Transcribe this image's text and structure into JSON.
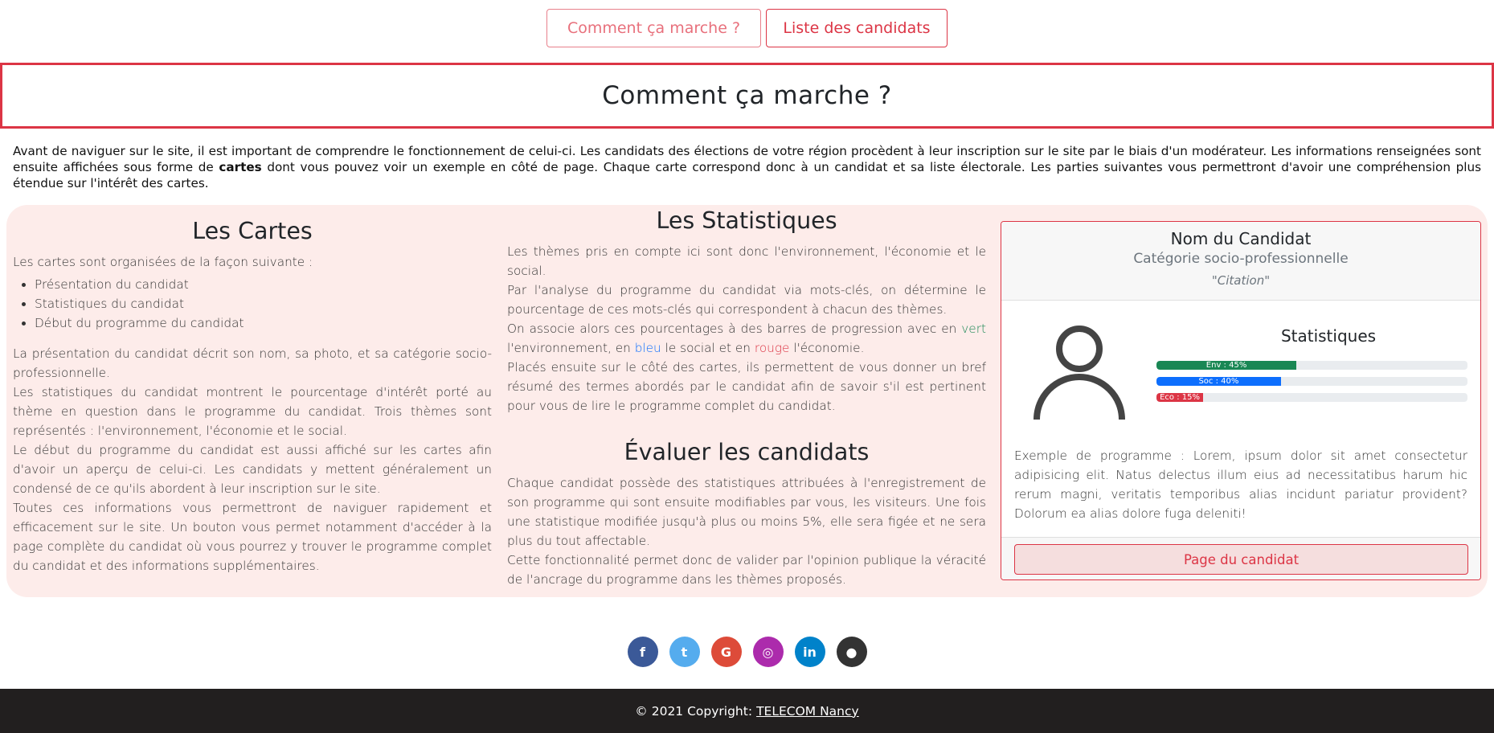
{
  "nav": {
    "how_label": "Comment ça marche ?",
    "list_label": "Liste des candidats"
  },
  "page_title": "Comment ça marche ?",
  "intro": {
    "part1": "Avant de naviguer sur le site, il est important de comprendre le fonctionnement de celui-ci. Les candidats des élections de votre région procèdent à leur inscription sur le site par le biais d'un modérateur. Les informations renseignées sont ensuite affichées sous forme de ",
    "bold": "cartes",
    "part2": " dont vous pouvez voir un exemple en côté de page. Chaque carte correspond donc à un candidat et sa liste électorale. Les parties suivantes vous permettront d'avoir une compréhension plus étendue sur l'intérêt des cartes."
  },
  "cards_section": {
    "title": "Les Cartes",
    "lead": "Les cartes sont organisées de la façon suivante :",
    "items": [
      "Présentation du candidat",
      "Statistiques du candidat",
      "Début du programme du candidat"
    ],
    "p1": "La présentation du candidat décrit son nom, sa photo, et sa catégorie socio-professionnelle.",
    "p2": "Les statistiques du candidat montrent le pourcentage d'intérêt porté au thème en question dans le programme du candidat. Trois thèmes sont représentés : l'environnement, l'économie et le social.",
    "p3": "Le début du programme du candidat est aussi affiché sur les cartes afin d'avoir un aperçu de celui-ci. Les candidats y mettent généralement un condensé de ce qu'ils abordent à leur inscription sur le site.",
    "p4": "Toutes ces informations vous permettront de naviguer rapidement et efficacement sur le site. Un bouton vous permet notamment d'accéder à la page complète du candidat où vous pourrez y trouver le programme complet du candidat et des informations supplémentaires."
  },
  "stats_section": {
    "title": "Les Statistiques",
    "p1": "Les thèmes pris en compte ici sont donc l'environnement, l'économie et le social.",
    "p2": "Par l'analyse du programme du candidat via mots-clés, on détermine le pourcentage de ces mots-clés qui correspondent à chacun des thèmes.",
    "p3a": "On associe alors ces pourcentages à des barres de progression avec en ",
    "green": "vert",
    "p3b": " l'environnement, en ",
    "blue": "bleu",
    "p3c": " le social et en ",
    "red": "rouge",
    "p3d": " l'économie.",
    "p4": "Placés ensuite sur le côté des cartes, ils permettent de vous donner un bref résumé des termes abordés par le candidat afin de savoir s'il est pertinent pour vous de lire le programme complet du candidat."
  },
  "eval_section": {
    "title": "Évaluer les candidats",
    "p1": "Chaque candidat possède des statistiques attribuées à l'enregistrement de son programme qui sont ensuite modifiables par vous, les visiteurs. Une fois une statistique modifiée jusqu'à plus ou moins 5%, elle sera figée et ne sera plus du tout affectable.",
    "p2": "Cette fonctionnalité permet donc de valider par l'opinion publique la véracité de l'ancrage du programme dans les thèmes proposés."
  },
  "card": {
    "name": "Nom du Candidat",
    "category": "Catégorie socio-professionnelle",
    "quote": "\"Citation\"",
    "stats_title": "Statistiques",
    "bars": [
      {
        "label": "Env : 45%",
        "value": 45,
        "color": "#198754"
      },
      {
        "label": "Soc : 40%",
        "value": 40,
        "color": "#0d6efd"
      },
      {
        "label": "Eco : 15%",
        "value": 15,
        "color": "#dc3545"
      }
    ],
    "program": "Exemple de programme : Lorem, ipsum dolor sit amet consectetur adipisicing elit. Natus delectus illum eius ad necessitatibus harum hic rerum magni, veritatis temporibus alias incidunt pariatur provident? Dolorum ea alias dolore fuga deleniti!",
    "button_label": "Page du candidat"
  },
  "socials": [
    {
      "icon": "facebook-icon",
      "glyph": "f",
      "color": "#3b5998"
    },
    {
      "icon": "twitter-icon",
      "glyph": "t",
      "color": "#55acee"
    },
    {
      "icon": "google-icon",
      "glyph": "G",
      "color": "#dd4b39"
    },
    {
      "icon": "instagram-icon",
      "glyph": "◎",
      "color": "#ac2bac"
    },
    {
      "icon": "linkedin-icon",
      "glyph": "in",
      "color": "#0082ca"
    },
    {
      "icon": "github-icon",
      "glyph": "●",
      "color": "#333333"
    }
  ],
  "footer": {
    "copyright": "© 2021 Copyright:",
    "link": "TELECOM Nancy"
  }
}
